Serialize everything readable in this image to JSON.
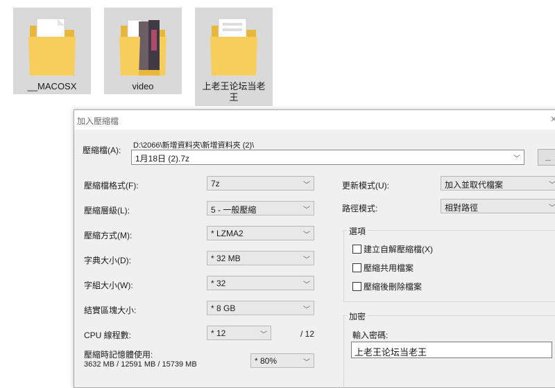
{
  "desktop": {
    "folders": [
      {
        "label": "__MACOSX"
      },
      {
        "label": "video"
      },
      {
        "label": "上老王论坛当老王"
      }
    ]
  },
  "dialog": {
    "title": "加入壓縮檔",
    "archive": {
      "label": "壓縮檔(A):",
      "path": "D:\\2066\\新增資料夾\\新增資料夾 (2)\\",
      "filename": "1月18日 (2).7z",
      "browse_label": "..."
    },
    "options": {
      "format": {
        "label": "壓縮檔格式(F):",
        "value": "7z"
      },
      "level": {
        "label": "壓縮層級(L):",
        "value": "5 - 一般壓縮"
      },
      "method": {
        "label": "壓縮方式(M):",
        "value": "* LZMA2"
      },
      "dict": {
        "label": "字典大小(D):",
        "value": "* 32 MB"
      },
      "word": {
        "label": "字組大小(W):",
        "value": "* 32"
      },
      "solid": {
        "label": "結實區塊大小:",
        "value": "* 8 GB"
      },
      "cpu": {
        "label": "CPU 線程數:",
        "value": "* 12",
        "max": "/ 12"
      },
      "memory": {
        "label": "壓縮時記憶體使用:",
        "detail": "3632 MB / 12591 MB / 15739 MB",
        "value": "* 80%"
      }
    },
    "update": {
      "label": "更新模式(U):",
      "value": "加入並取代檔案"
    },
    "path_mode": {
      "label": "路徑模式:",
      "value": "相對路徑"
    },
    "opts_group": {
      "title": "選項",
      "sfx": "建立自解壓縮檔(X)",
      "shared": "壓縮共用檔案",
      "delete": "壓縮後刪除檔案"
    },
    "encrypt": {
      "title": "加密",
      "password_label": "輸入密碼:",
      "password_value": "上老王论坛当老王"
    },
    "colors": {
      "tile": "#d9d9d9",
      "dialog_bg": "#f0f0f0",
      "folder": "#f5c842"
    }
  }
}
